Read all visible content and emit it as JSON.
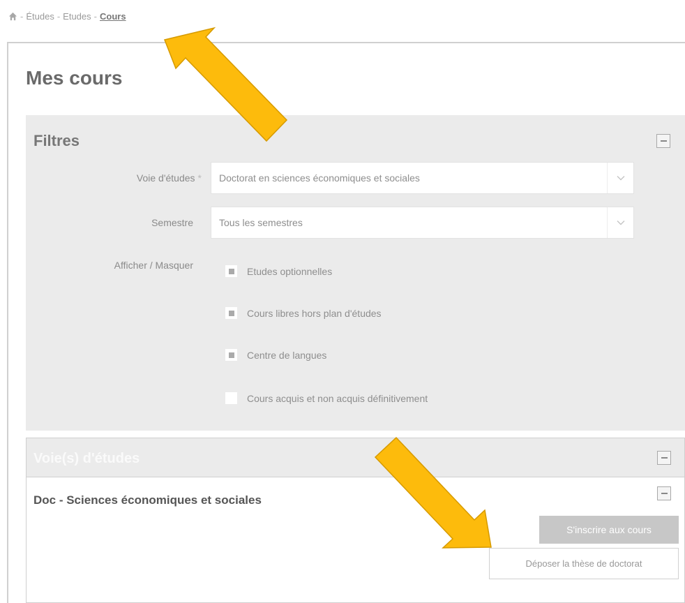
{
  "breadcrumb": {
    "items": [
      "Études",
      "Etudes"
    ],
    "separator": "-",
    "current": "Cours"
  },
  "page": {
    "title": "Mes cours"
  },
  "filters": {
    "title": "Filtres",
    "voie_label": "Voie d'études",
    "required_mark": "*",
    "voie_value": "Doctorat en sciences économiques et sociales",
    "semestre_label": "Semestre",
    "semestre_value": "Tous les semestres",
    "toggle_label": "Afficher / Masquer",
    "options": [
      {
        "label": "Etudes optionnelles",
        "checked": true
      },
      {
        "label": "Cours libres hors plan d'études",
        "checked": true
      },
      {
        "label": "Centre de langues",
        "checked": true
      },
      {
        "label": "Cours acquis et non acquis définitivement",
        "checked": false
      }
    ]
  },
  "voies": {
    "title": "Voie(s) d'études",
    "program_title": "Doc - Sciences économiques et sociales",
    "register_button": "S'inscrire aux cours",
    "submit_thesis_button": "Déposer la thèse de doctorat"
  },
  "colors": {
    "annotation_arrow": "#FDBB0C",
    "panel_bg": "#EBEBEB",
    "button_gray": "#C7C7C7"
  },
  "icons": {
    "home": "home-icon",
    "collapse": "minus-icon",
    "dropdown": "chevron-down-icon"
  }
}
